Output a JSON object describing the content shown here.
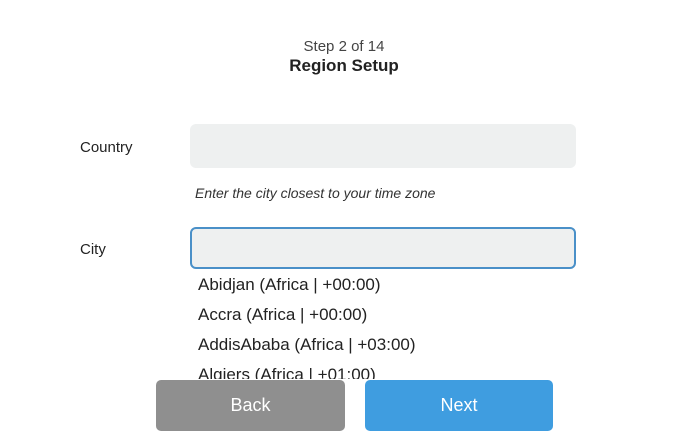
{
  "header": {
    "step": "Step 2 of 14",
    "title": "Region Setup"
  },
  "form": {
    "country_label": "Country",
    "country_value": "",
    "hint": "Enter the city closest to your time zone",
    "city_label": "City",
    "city_value": ""
  },
  "city_options": [
    "Abidjan (Africa | +00:00)",
    "Accra (Africa | +00:00)",
    "AddisAbaba (Africa | +03:00)",
    "Algiers (Africa | +01:00)"
  ],
  "buttons": {
    "back_label": "Back",
    "next_label": "Next"
  },
  "colors": {
    "focus_border": "#4a90c8",
    "back_button": "#8f8f8f",
    "next_button": "#3f9de0",
    "input_background": "#eef0f0"
  }
}
